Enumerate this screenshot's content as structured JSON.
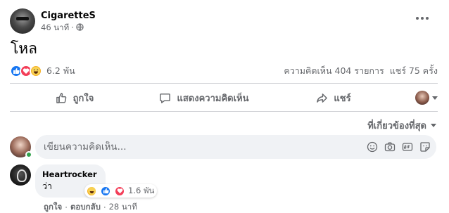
{
  "post": {
    "author": "CigaretteS",
    "time": "46 นาที",
    "separator": "·",
    "text": "โหล"
  },
  "reactions": {
    "count": "6.2 พัน",
    "comments": "ความคิดเห็น 404 รายการ",
    "shares": "แชร์ 75 ครั้ง"
  },
  "actions": {
    "like": "ถูกใจ",
    "comment": "แสดงความคิดเห็น",
    "share": "แชร์"
  },
  "sort": {
    "label": "ที่เกี่ยวข้องที่สุด"
  },
  "composer": {
    "placeholder": "เขียนความคิดเห็น..."
  },
  "comment": {
    "author": "Heartrocker",
    "text": "ว่า",
    "reaction_count": "1.6 พัน",
    "like": "ถูกใจ",
    "reply": "ตอบกลับ",
    "time": "28 นาที",
    "separator": "·"
  },
  "colors": {
    "like": "#1877f2",
    "love": "#f33e58",
    "haha": "#f7b125",
    "secondary_text": "#65676b",
    "online": "#31a24c"
  }
}
